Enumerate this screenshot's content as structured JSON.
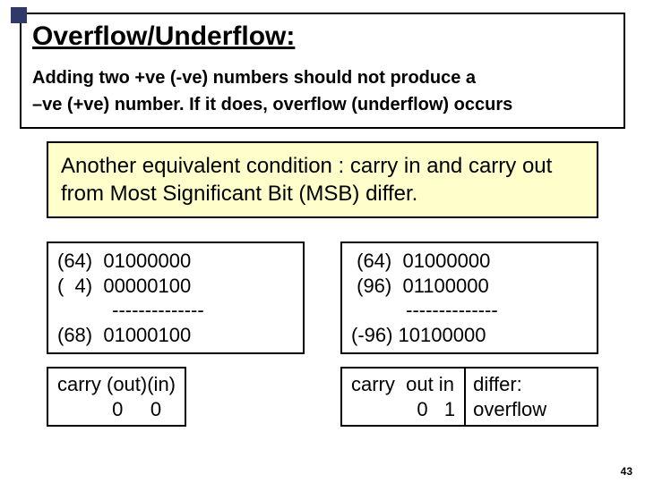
{
  "header": {
    "title": "Overflow/Underflow:",
    "line1": "Adding two +ve (-ve) numbers  should not produce a",
    "line2": " –ve (+ve) number. If it does, overflow  (underflow) occurs"
  },
  "condition": " Another equivalent condition : carry in and carry out from Most Significant Bit (MSB) differ.",
  "left": {
    "calc": "(64)  01000000\n(  4)  00000100\n          --------------\n(68)  01000100",
    "carry": "carry (out)(in)\n          0     0"
  },
  "right": {
    "calc": " (64)  01000000\n (96)  01100000\n          --------------\n(-96) 10100000",
    "carry": "carry  out in\n            0   1",
    "differ": "differ:\noverflow"
  },
  "page": "43"
}
